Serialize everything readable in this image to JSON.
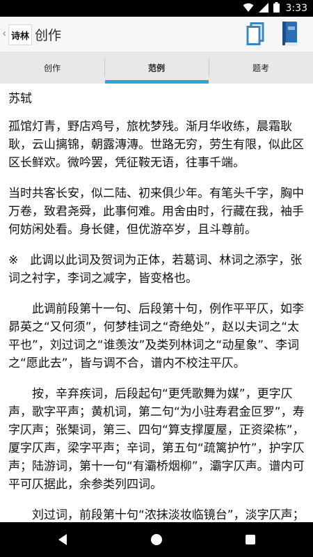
{
  "status_bar": {
    "time": "3:33"
  },
  "app_bar": {
    "back_glyph": "‹",
    "logo_text": "诗林",
    "title": "创作",
    "icons": [
      "copy-icon",
      "book-icon"
    ]
  },
  "tabs": [
    {
      "label": "创作"
    },
    {
      "label": "范例"
    },
    {
      "label": "题考"
    }
  ],
  "active_tab": 1,
  "content": {
    "author": "苏轼",
    "stanza1": "孤馆灯青，野店鸡号，旅枕梦残。渐月华收练，晨霜耿耿，云山摛锦，朝露漙漙。世路无穷，劳生有限，似此区区长鲜欢。微吟罢，凭征鞍无语，往事千端。",
    "stanza2": "当时共客长安，似二陆、初来俱少年。有笔头千字，胸中万卷，致君尧舜，此事何难。用舍由时，行藏在我，袖手何妨闲处看。身长健，但优游卒岁，且斗尊前。",
    "note1": "※　此调以此词及贺词为正体，若葛词、林词之添字，张词之衬字，李词之减字，皆变格也。",
    "note2": "　　此调前段第十一句、后段第十句，例作平平仄，如李昴英之“又何须”，何梦桂词之“奇绝处”，赵以夫词之“太平也”，刘过词之“谁羡汝”及类列林词之“动星象”、李词之“愿此去”，皆与调不合，谱内不校注平仄。",
    "note3": "　　按，辛弃疾词，后段起句“更凭歌舞为媒”，更字仄声，歌字平声；黄机词，第二句“为小驻寿君金叵罗”，寿字仄声；张榘词，第三、四句“算支撑厦屋，正资梁栋”，厦字仄声，梁字平声；辛词，第五句“疏篱护竹”，护字仄声；陆游词，第十一句“有灞桥烟柳”，灞字仄声。谱内可平可仄据此，余参类列四词。",
    "note4": "　　刘过词，前段第十句“浓抹淡妆临镜台”，淡字仄声；后段起句“白云天竺去来”，去字仄声；第七句“通"
  },
  "nav_bar": {
    "buttons": [
      "back-nav-icon",
      "home-nav-icon",
      "recents-nav-icon"
    ]
  },
  "colors": {
    "accent": "#2aa7d8",
    "status_bar": "#000000",
    "app_bar": "#f7f7f7",
    "tab_bar": "#e8e8e8"
  }
}
